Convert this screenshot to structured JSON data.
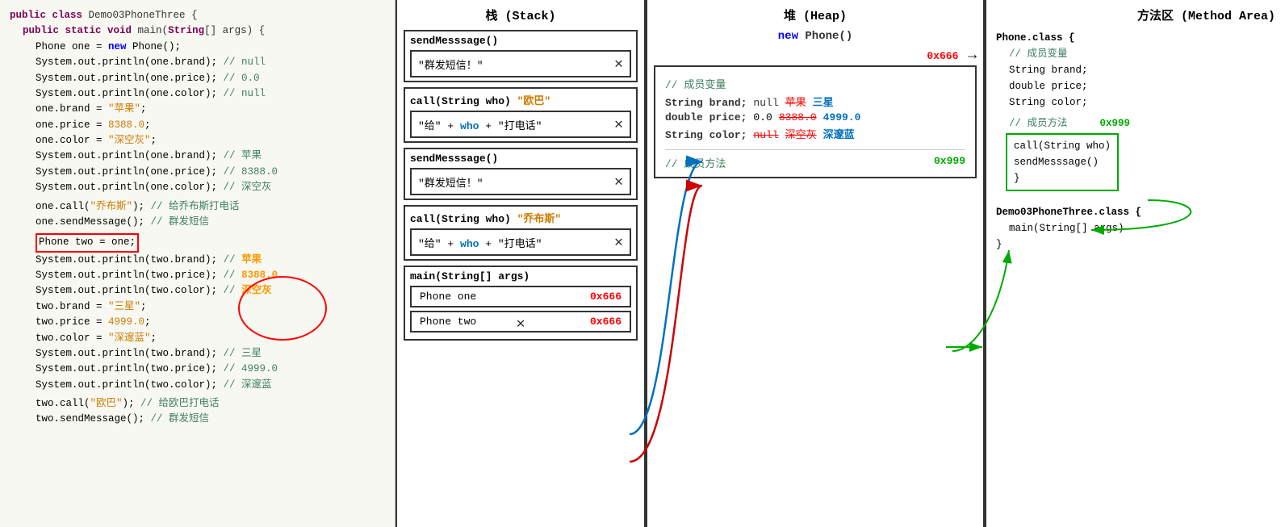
{
  "header": {
    "stack_title": "栈 (Stack)",
    "heap_title": "堆 (Heap)",
    "method_title": "方法区 (Method Area)"
  },
  "code": {
    "class_decl": "public class Demo03PhoneThree {",
    "main_decl": "    public static void main(String[] args) {",
    "lines": [
      "        Phone one = new Phone();",
      "        System.out.println(one.brand); // null",
      "        System.out.println(one.price); // 0.0",
      "        System.out.println(one.color); // null",
      "        one.brand = \"苹果\";",
      "        one.price = 8388.0;",
      "        one.color = \"深空灰\";",
      "        System.out.println(one.brand); // 苹果",
      "        System.out.println(one.price); // 8388.0",
      "        System.out.println(one.color); // 深空灰",
      "",
      "        one.call(\"乔布斯\"); // 给乔布斯打电话",
      "        one.sendMessage(); // 群发短信",
      "",
      "        Phone two = one;",
      "        System.out.println(two.brand); // 苹果",
      "        System.out.println(two.price); // 8388.0",
      "        System.out.println(two.color); // 深空灰",
      "        two.brand = \"三星\";",
      "        two.price = 4999.0;",
      "        two.color = \"深邃蓝\";",
      "        System.out.println(two.brand); // 三星",
      "        System.out.println(two.price); // 4999.0",
      "        System.out.println(two.color); // 深邃蓝",
      "",
      "        two.call(\"欧巴\"); // 给欧巴打电话",
      "        two.sendMessage(); // 群发短信"
    ]
  },
  "stack": {
    "frames": [
      {
        "title": "sendMesssage()",
        "content": "\"群发短信！\""
      },
      {
        "title": "call(String who) \"欧巴\"",
        "content": "\"给\" + who + \"打电话\""
      },
      {
        "title": "sendMesssage()",
        "content": "\"群发短信！\""
      },
      {
        "title": "call(String who) \"乔布斯\"",
        "content": "\"给\" + who + \"打电话\""
      },
      {
        "title": "main(String[] args)",
        "phones": [
          {
            "name": "Phone one",
            "addr": "0x666"
          },
          {
            "name": "Phone two",
            "addr": "0x666"
          }
        ]
      }
    ]
  },
  "heap": {
    "new_phone": "new Phone()",
    "addr": "0x666",
    "members_var_label": "// 成员变量",
    "brand_label": "String brand;",
    "price_label": "double price;",
    "color_label": "String color;",
    "brand_vals": [
      "null",
      "苹果",
      "三星"
    ],
    "price_vals": [
      "0.0",
      "8388.0",
      "4999.0"
    ],
    "color_vals": [
      "null",
      "深空灰",
      "深邃蓝"
    ],
    "member_method_label": "// 成员方法",
    "method_addr": "0x999"
  },
  "method": {
    "phone_class": "Phone.class {",
    "comment_var": "// 成员变量",
    "brand": "String brand;",
    "price": "double price;",
    "color": "String color;",
    "comment_method": "// 成员方法",
    "method_addr": "0x999",
    "call": "call(String who)",
    "send": "sendMesssage()",
    "close_brace": "}",
    "demo_class": "Demo03PhoneThree.class {",
    "main_sig": "main(String[] args)",
    "demo_close": "}"
  },
  "colors": {
    "keyword_purple": "#7f0055",
    "keyword_blue": "#0000ff",
    "string_orange": "#ce7b00",
    "comment_green": "#3f7f5f",
    "red": "#ff0000",
    "dark_green": "#00aa00",
    "blue_addr": "#0070c0"
  }
}
